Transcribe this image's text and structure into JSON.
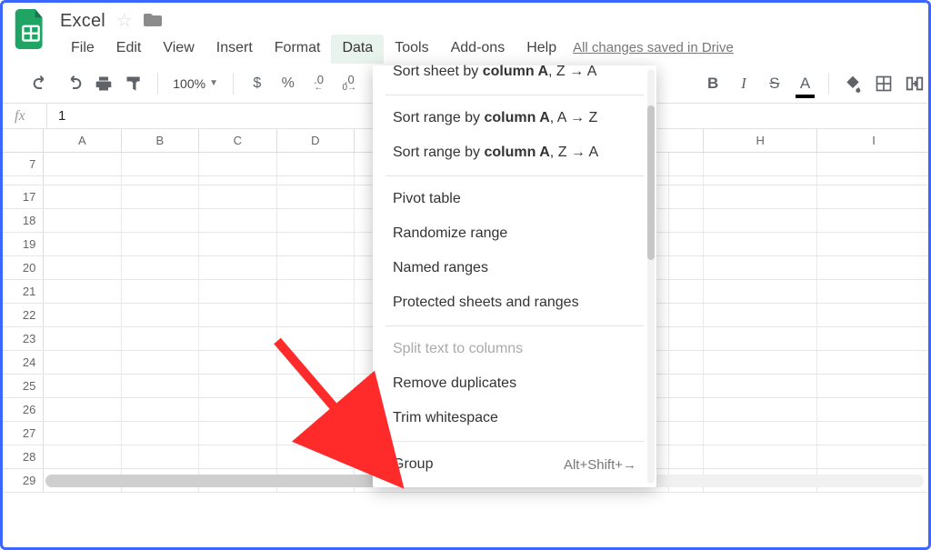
{
  "doc": {
    "title": "Excel"
  },
  "menus": {
    "file": "File",
    "edit": "Edit",
    "view": "View",
    "insert": "Insert",
    "format": "Format",
    "data": "Data",
    "tools": "Tools",
    "addons": "Add-ons",
    "help": "Help",
    "save_status": "All changes saved in Drive"
  },
  "toolbar": {
    "zoom": "100%",
    "currency": "$",
    "percent": "%",
    "dec_minus": ".0",
    "dec_plus": ".0",
    "bold": "B",
    "italic": "I",
    "strike": "S",
    "textcolor": "A"
  },
  "fx": {
    "label": "fx",
    "value": "1"
  },
  "columns": [
    "A",
    "B",
    "C",
    "D",
    "",
    "",
    "",
    "H",
    "I"
  ],
  "row_numbers": [
    "7",
    "",
    "17",
    "18",
    "19",
    "20",
    "21",
    "22",
    "23",
    "24",
    "25",
    "26",
    "27",
    "28",
    "29"
  ],
  "dropdown": {
    "sort_sheet_za_prefix": "Sort sheet by ",
    "sort_sheet_za_col": "column A",
    "sort_sheet_za_suffix": ", Z → A",
    "sort_range_az_prefix": "Sort range by ",
    "sort_range_az_col": "column A",
    "sort_range_az_suffix": ", A → Z",
    "sort_range_za_prefix": "Sort range by ",
    "sort_range_za_col": "column A",
    "sort_range_za_suffix": ", Z → A",
    "pivot": "Pivot table",
    "randomize": "Randomize range",
    "named": "Named ranges",
    "protected": "Protected sheets and ranges",
    "split": "Split text to columns",
    "remove_dups": "Remove duplicates",
    "trim": "Trim whitespace",
    "group": "Group",
    "group_kbd": "Alt+Shift+→"
  }
}
